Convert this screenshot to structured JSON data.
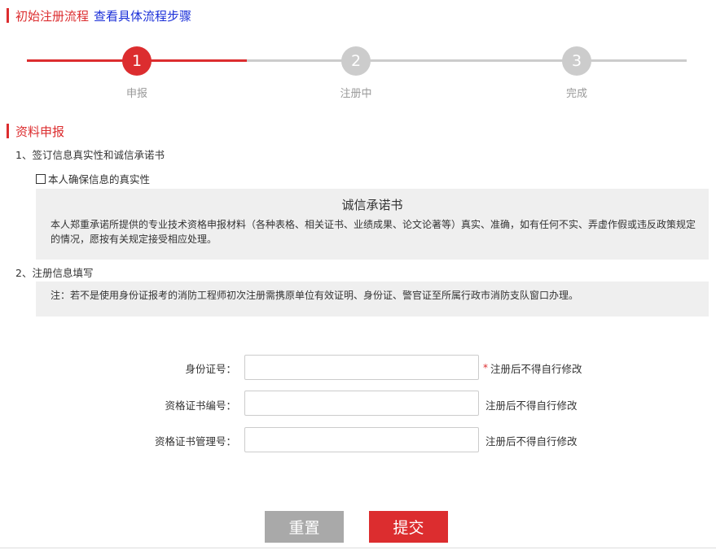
{
  "header": {
    "title": "初始注册流程",
    "link": "查看具体流程步骤",
    "accent_color": "#dc2d2f",
    "link_color": "#1a2fd8"
  },
  "steps": [
    {
      "number": "1",
      "label": "申报",
      "state": "active"
    },
    {
      "number": "2",
      "label": "注册中",
      "state": "pending"
    },
    {
      "number": "3",
      "label": "完成",
      "state": "pending"
    }
  ],
  "section": {
    "title": "资料申报",
    "item1": "1、签订信息真实性和诚信承诺书",
    "checkbox_label": "本人确保信息的真实性",
    "checkbox_checked": false,
    "pledge_title": "诚信承诺书",
    "pledge_text": "本人郑重承诺所提供的专业技术资格申报材料（各种表格、相关证书、业绩成果、论文论著等）真实、准确，如有任何不实、弄虚作假或违反政策规定的情况，愿按有关规定接受相应处理。",
    "item2": "2、注册信息填写",
    "note": "注：若不是使用身份证报考的消防工程师初次注册需携原单位有效证明、身份证、警官证至所属行政市消防支队窗口办理。"
  },
  "form": {
    "id_label": "身份证号：",
    "id_value": "",
    "id_required": "*",
    "id_hint": "注册后不得自行修改",
    "cert_no_label": "资格证书编号：",
    "cert_no_value": "",
    "cert_no_hint": "注册后不得自行修改",
    "cert_mgmt_label": "资格证书管理号：",
    "cert_mgmt_value": "",
    "cert_mgmt_hint": "注册后不得自行修改"
  },
  "buttons": {
    "reset": "重置",
    "submit": "提交"
  }
}
